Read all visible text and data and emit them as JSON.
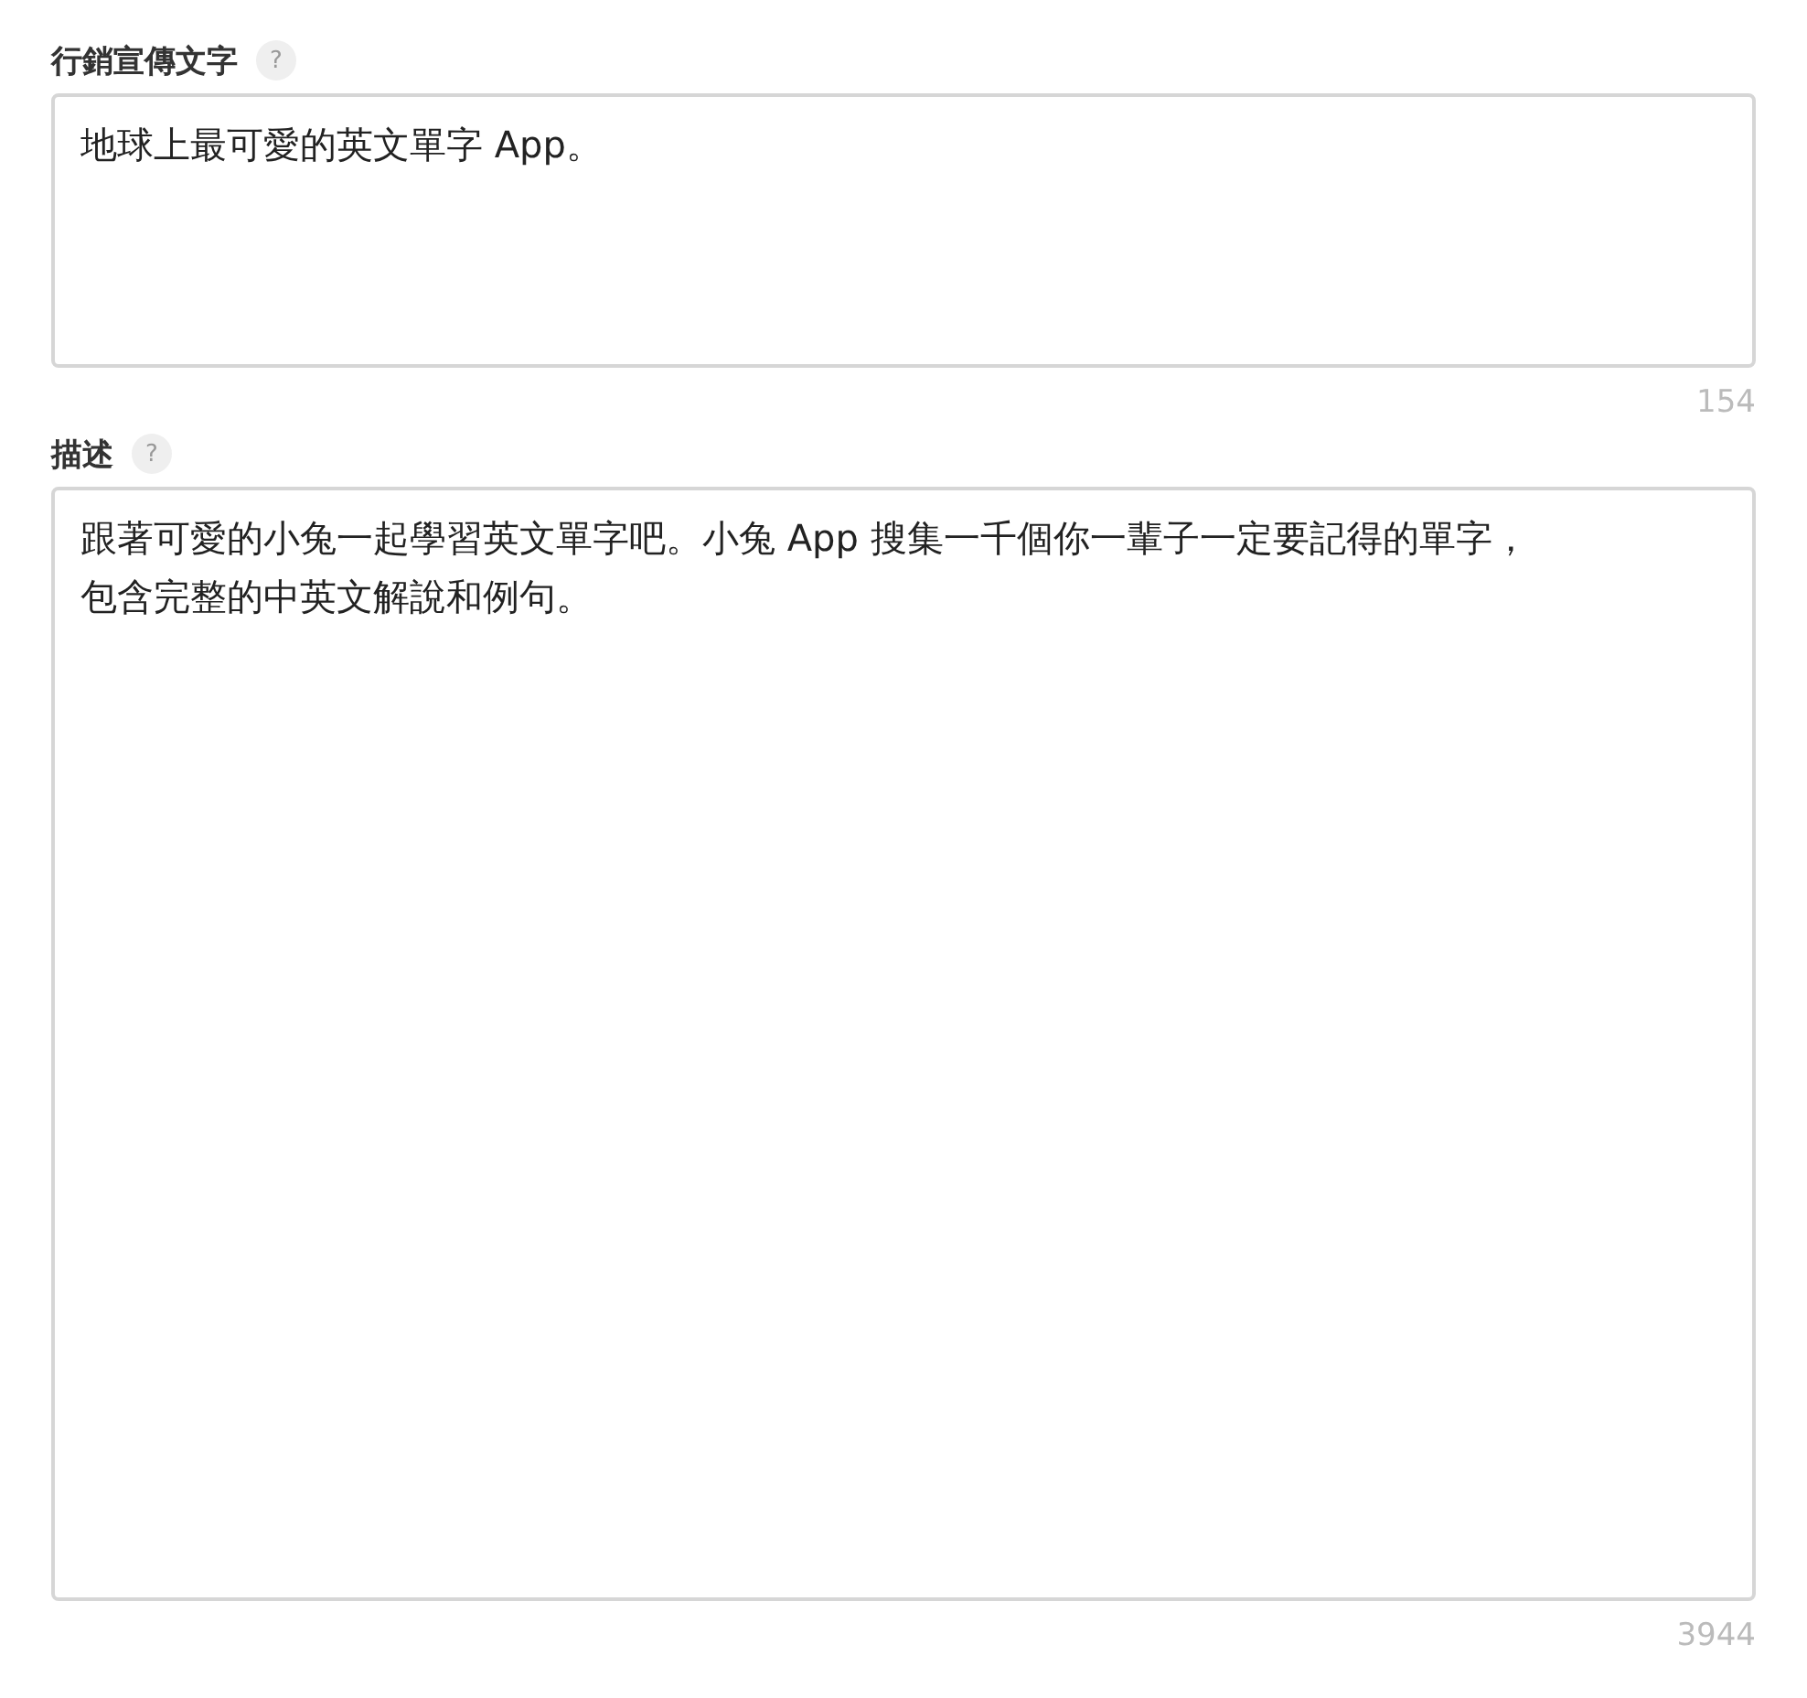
{
  "fields": [
    {
      "label": "行銷宣傳文字",
      "help": "?",
      "lines": [
        "地球上最可愛的英文單字 App。"
      ],
      "counter": "154",
      "kind": "short"
    },
    {
      "label": "描述",
      "help": "?",
      "lines": [
        "跟著可愛的小兔一起學習英文單字吧。小兔 App 搜集一千個你一輩子一定要記得的單字，",
        "包含完整的中英文解說和例句。"
      ],
      "counter": "3944",
      "kind": "long"
    }
  ]
}
